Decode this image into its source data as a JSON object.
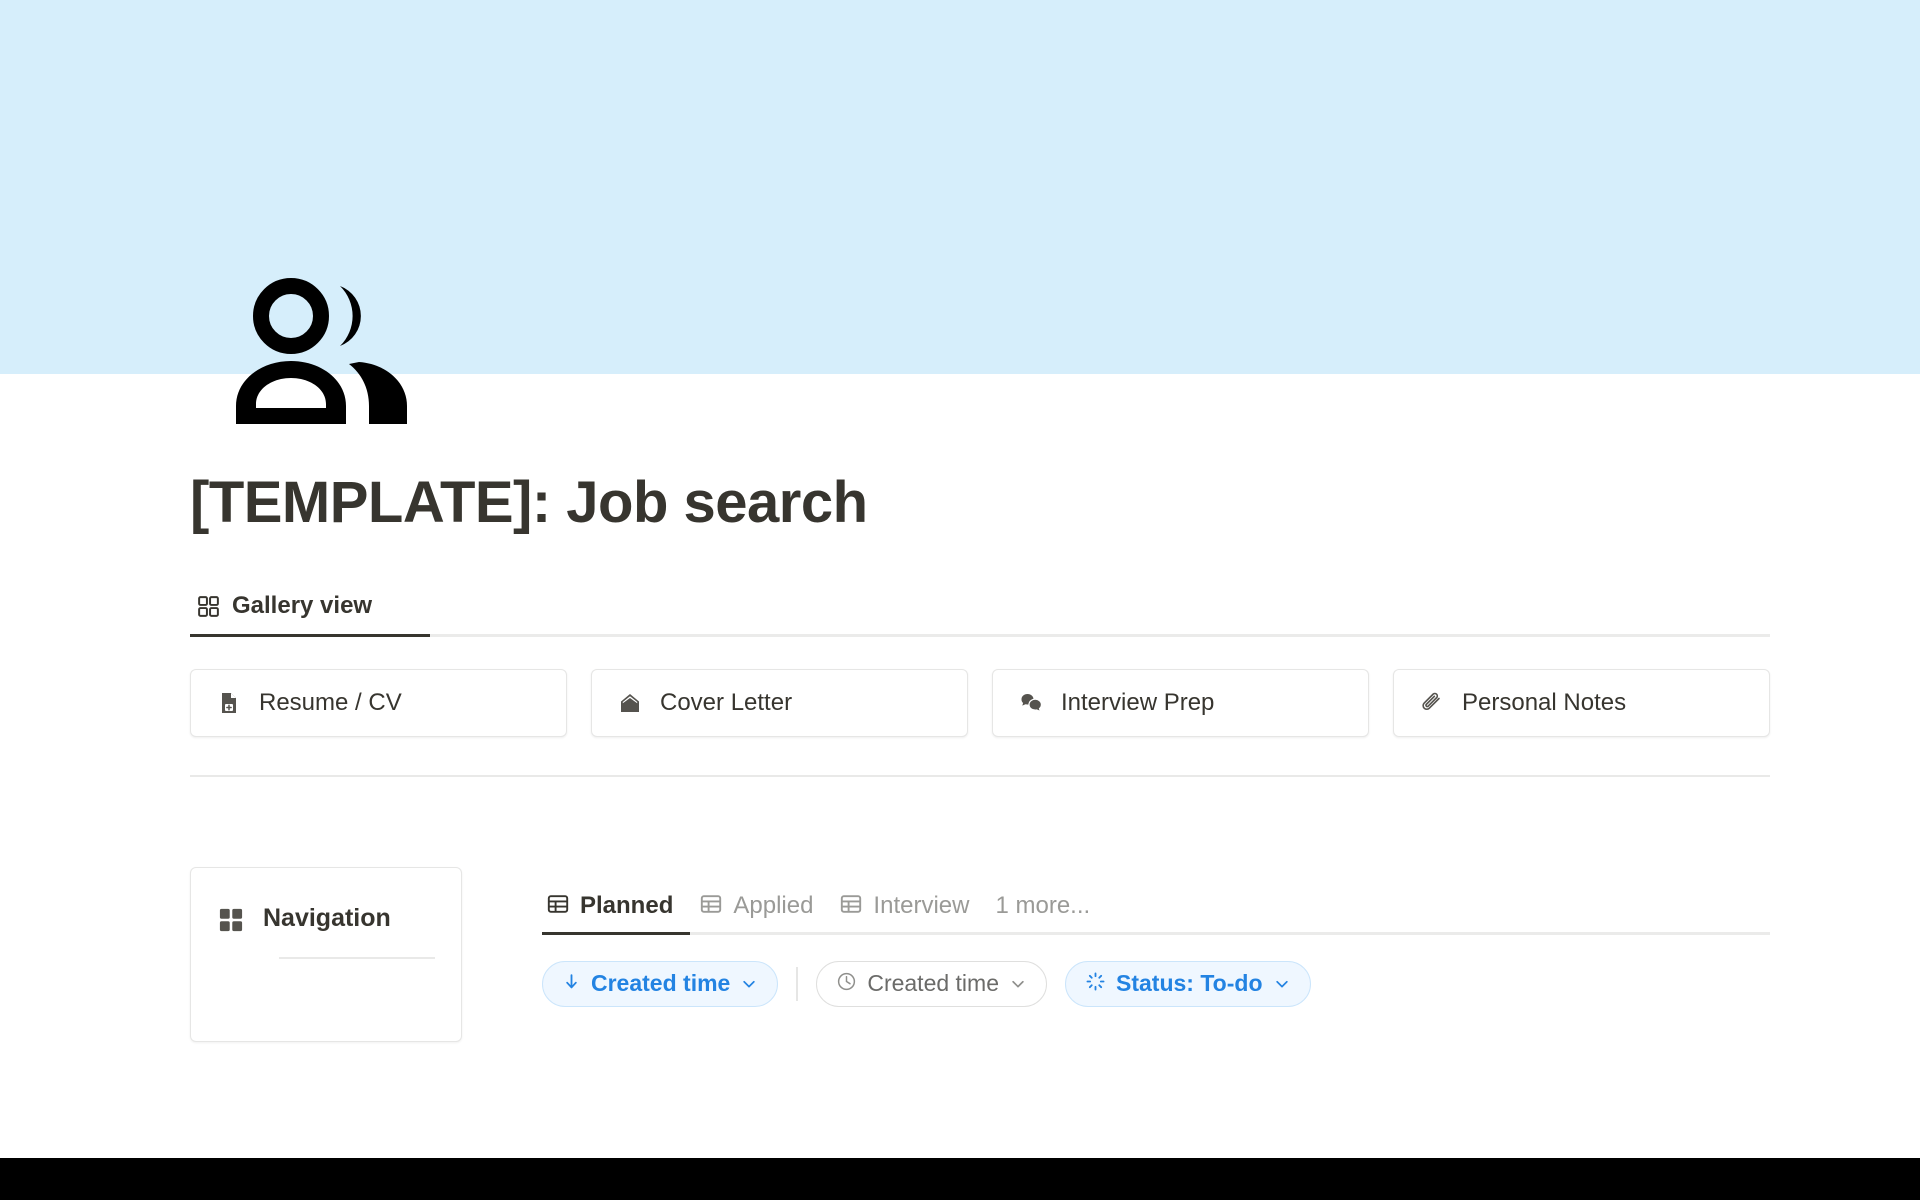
{
  "cover": {
    "color": "#d6eefb",
    "icon": "people-icon"
  },
  "page": {
    "title": "[TEMPLATE]: Job search"
  },
  "view_bar": {
    "tabs": [
      {
        "label": "Gallery view",
        "icon": "gallery-grid-icon",
        "active": true
      }
    ]
  },
  "quick_links": [
    {
      "label": "Resume / CV",
      "icon": "document-plus-icon"
    },
    {
      "label": "Cover Letter",
      "icon": "open-envelope-icon"
    },
    {
      "label": "Interview Prep",
      "icon": "speech-bubbles-icon"
    },
    {
      "label": "Personal Notes",
      "icon": "paperclip-icon"
    }
  ],
  "nav_card": {
    "title": "Navigation",
    "icon": "four-squares-icon"
  },
  "database": {
    "tabs": [
      {
        "label": "Planned",
        "icon": "table-icon",
        "active": true
      },
      {
        "label": "Applied",
        "icon": "table-icon",
        "active": false
      },
      {
        "label": "Interview",
        "icon": "table-icon",
        "active": false
      }
    ],
    "more_label": "1 more...",
    "pills": [
      {
        "label": "Created time",
        "icon": "sort-down-arrow-icon",
        "style": "blue",
        "has_chevron": true
      },
      {
        "label": "Created time",
        "icon": "clock-icon",
        "style": "neutral",
        "has_chevron": true
      },
      {
        "label": "Status: To-do",
        "icon": "status-spinner-icon",
        "style": "blue",
        "has_chevron": true
      }
    ]
  },
  "colors": {
    "accent_blue": "#2383e2",
    "pill_blue_bg": "#eff7ff",
    "text_primary": "#37352f",
    "text_muted": "#9a9a97"
  }
}
